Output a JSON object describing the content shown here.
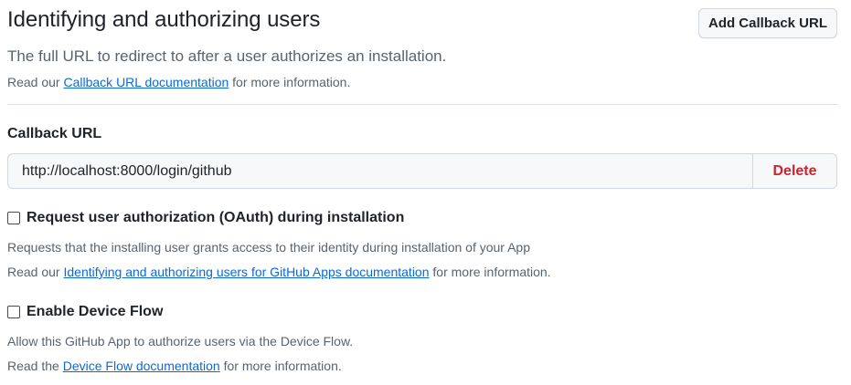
{
  "header": {
    "title": "Identifying and authorizing users",
    "add_button": "Add Callback URL",
    "subtitle": "The full URL to redirect to after a user authorizes an installation.",
    "doc_prefix": "Read our ",
    "doc_link": "Callback URL documentation",
    "doc_suffix": " for more information."
  },
  "callback": {
    "label": "Callback URL",
    "value": "http://localhost:8000/login/github",
    "delete_label": "Delete"
  },
  "oauth": {
    "label": "Request user authorization (OAuth) during installation",
    "checked": false,
    "description": "Requests that the installing user grants access to their identity during installation of your App",
    "doc_prefix": "Read our ",
    "doc_link": "Identifying and authorizing users for GitHub Apps documentation",
    "doc_suffix": " for more information."
  },
  "device_flow": {
    "label": "Enable Device Flow",
    "checked": false,
    "description": "Allow this GitHub App to authorize users via the Device Flow.",
    "doc_prefix": "Read the ",
    "doc_link": "Device Flow documentation",
    "doc_suffix": " for more information."
  },
  "colors": {
    "link": "#0969da",
    "danger": "#cf222e",
    "muted": "#59636e"
  }
}
